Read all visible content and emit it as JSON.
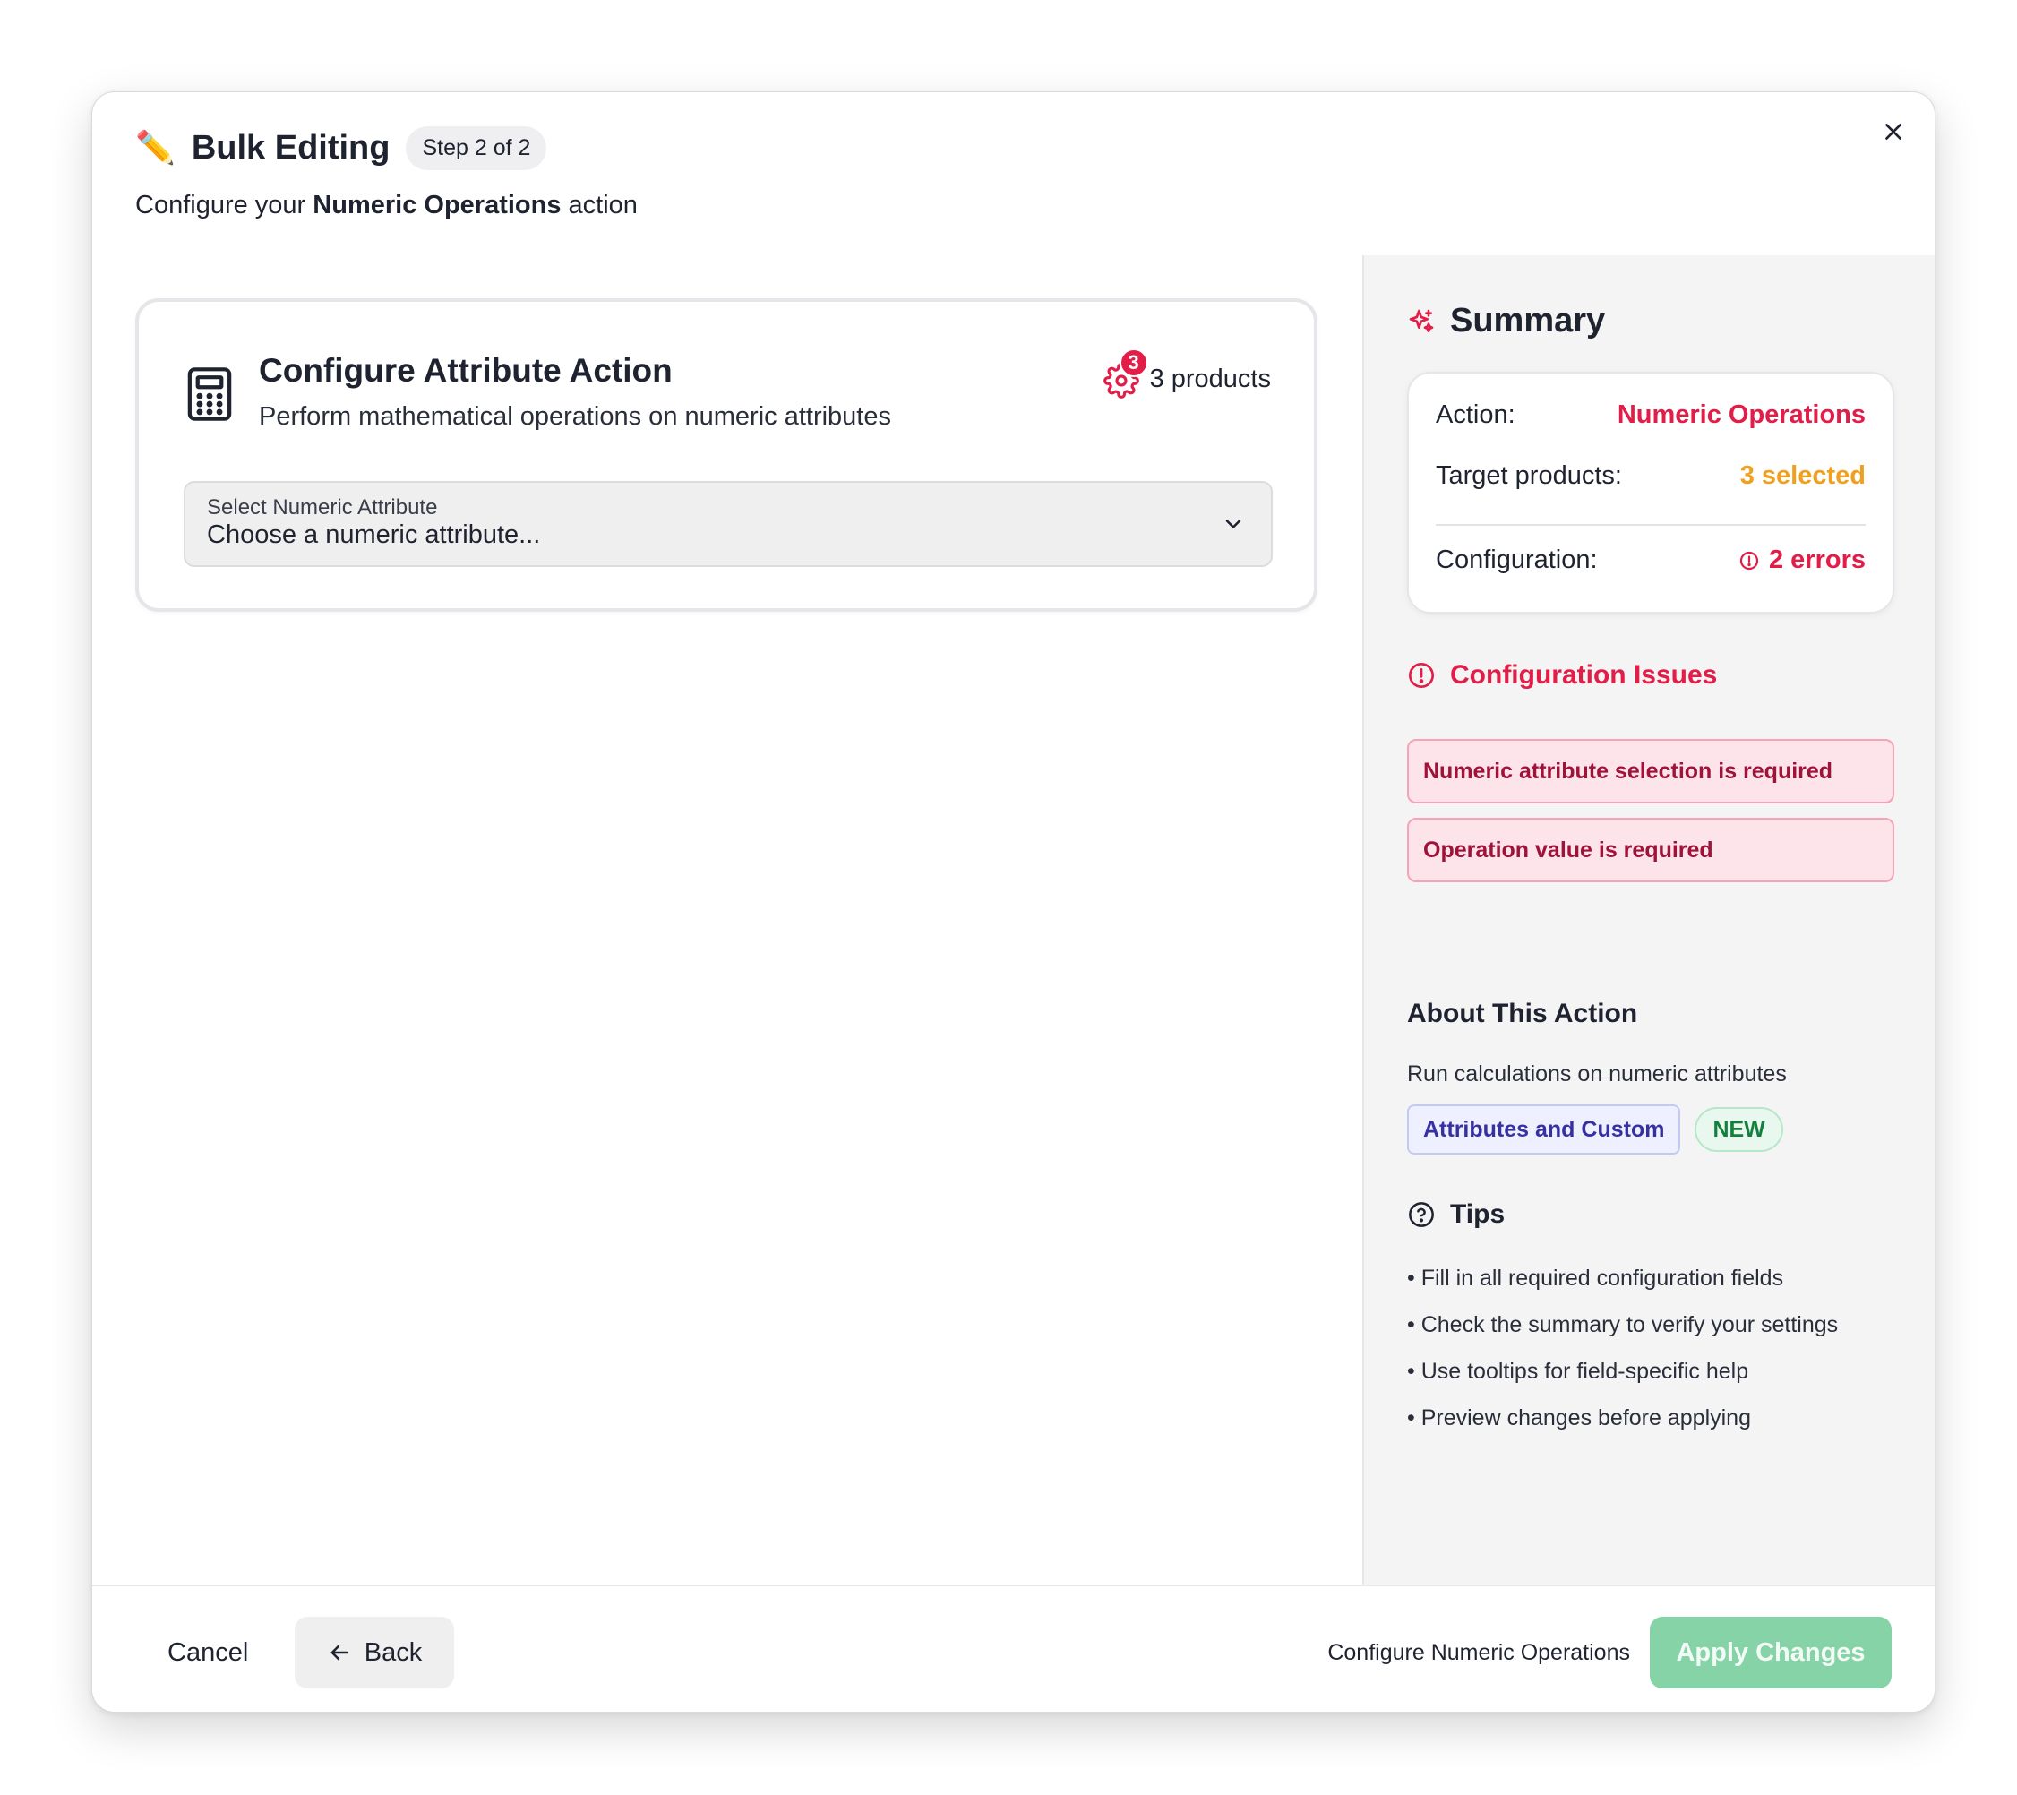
{
  "header": {
    "title": "Bulk Editing",
    "step_badge": "Step 2 of 2",
    "subtitle_prefix": "Configure your ",
    "subtitle_bold": "Numeric Operations",
    "subtitle_suffix": " action"
  },
  "config_card": {
    "title": "Configure Attribute Action",
    "description": "Perform mathematical operations on numeric attributes",
    "products_badge_count": "3",
    "products_label": "3 products",
    "select": {
      "label": "Select Numeric Attribute",
      "value": "Choose a numeric attribute..."
    }
  },
  "summary": {
    "title": "Summary",
    "rows": [
      {
        "label": "Action:",
        "value": "Numeric Operations"
      },
      {
        "label": "Target products:",
        "value": "3 selected"
      },
      {
        "label": "Configuration:",
        "value": "2 errors"
      }
    ]
  },
  "issues": {
    "title": "Configuration Issues",
    "items": [
      "Numeric attribute selection is required",
      "Operation value is required"
    ]
  },
  "about": {
    "title": "About This Action",
    "description": "Run calculations on numeric attributes",
    "tag_category": "Attributes and Custom",
    "tag_new": "NEW"
  },
  "tips": {
    "title": "Tips",
    "items": [
      "Fill in all required configuration fields",
      "Check the summary to verify your settings",
      "Use tooltips for field-specific help",
      "Preview changes before applying"
    ]
  },
  "footer": {
    "cancel_label": "Cancel",
    "back_label": "Back",
    "hint": "Configure Numeric Operations",
    "apply_label": "Apply Changes"
  },
  "colors": {
    "accent_pink": "#e11d48",
    "accent_amber": "#f0a020",
    "apply_green_disabled": "#86d3a8"
  },
  "icons": {
    "title": "pencil-icon",
    "close": "close-icon",
    "card": "calculator-icon",
    "products": "gear-icon",
    "select": "chevron-down-icon",
    "summary": "sparkles-icon",
    "issues": "alert-circle-icon",
    "tips": "help-circle-icon",
    "back": "arrow-left-icon"
  }
}
